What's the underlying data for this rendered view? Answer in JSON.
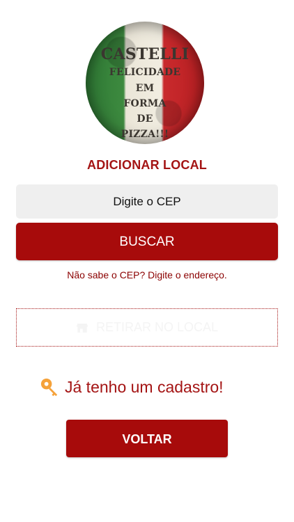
{
  "logo": {
    "brand": "CASTELLI",
    "lines": [
      "FELICIDADE",
      "EM",
      "FORMA",
      "DE",
      "PIZZA!!!"
    ],
    "colors": {
      "green": "#3d8a3f",
      "white": "#f1ede1",
      "red": "#c92a2d"
    }
  },
  "page_title": "ADICIONAR LOCAL",
  "cep": {
    "placeholder": "Digite o CEP",
    "value": ""
  },
  "buttons": {
    "search": "BUSCAR",
    "pickup": "RETIRAR NO LOCAL",
    "back": "VOLTAR"
  },
  "links": {
    "address": "Não sabe o CEP? Digite o endereço.",
    "registered": "Já tenho um cadastro!"
  },
  "icons": {
    "pickup": "store-icon",
    "registered": "key-icon"
  },
  "theme": {
    "primary": "#a70b0b",
    "title": "#a41414",
    "input_background": "#efefef",
    "pickup_text": "#f4f4f4",
    "key": "#f5a23a"
  }
}
